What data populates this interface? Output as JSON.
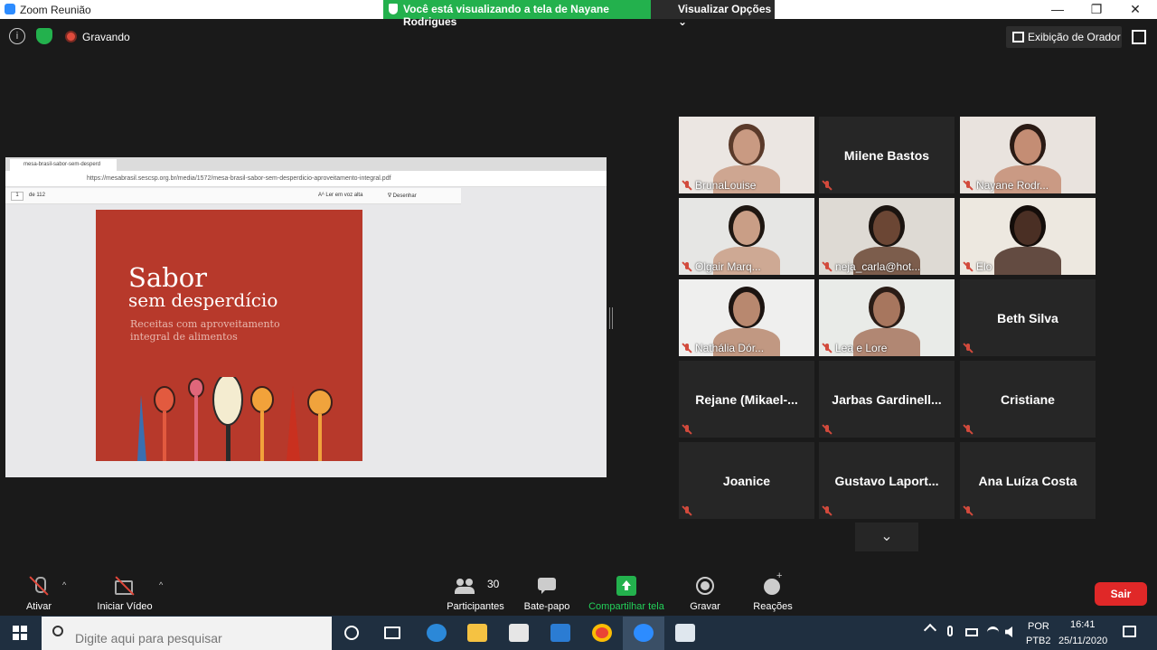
{
  "window": {
    "title": "Zoom Reunião",
    "share_banner": "Você está visualizando a tela de Nayane Rodrigues",
    "view_options": "Visualizar Opções ⌄",
    "minimize": "—",
    "maximize": "❐",
    "close": "✕"
  },
  "meeting": {
    "info_glyph": "i",
    "recording_label": "Gravando",
    "speaker_view_label": "Exibição de Orador"
  },
  "shared_screen": {
    "tab_title": "mesa-brasil-sabor-sem-desperd",
    "url": "https://mesabrasil.sescsp.org.br/media/1572/mesa-brasil-sabor-sem-desperdicio-aproveitamento-integral.pdf",
    "page_number": "1",
    "page_count": "de 112",
    "read_aloud": "Aᴬ Ler em voz alta",
    "draw": "∇ Desenhar",
    "cover_title_1": "Sabor",
    "cover_title_2": "sem desperdício",
    "cover_subtitle": "Receitas com aproveitamento integral de alimentos"
  },
  "participants": [
    {
      "name": "BrunaLouise",
      "video": true,
      "active": false,
      "skin": "#c99a82",
      "bg": "#ebe6e2",
      "hair": "#5a3a2a"
    },
    {
      "name": "Milene Bastos",
      "video": false,
      "active": false
    },
    {
      "name": "Nayane Rodr...",
      "video": true,
      "active": false,
      "skin": "#c48d74",
      "bg": "#e9e3de",
      "hair": "#2a1a14"
    },
    {
      "name": "Olgair Marq...",
      "video": true,
      "active": false,
      "skin": "#c99e86",
      "bg": "#e6e6e4",
      "hair": "#1f1712"
    },
    {
      "name": "neja_carla@hot...",
      "video": true,
      "active": true,
      "skin": "#6b4634",
      "bg": "#dedad4",
      "hair": "#1b1410"
    },
    {
      "name": "Elo",
      "video": true,
      "active": false,
      "skin": "#4a2f24",
      "bg": "#ede8e0",
      "hair": "#140d0a"
    },
    {
      "name": "Nathália Dór...",
      "video": true,
      "active": false,
      "skin": "#b8886f",
      "bg": "#efefee",
      "hair": "#1c1411"
    },
    {
      "name": "Lea e Lore",
      "video": true,
      "active": false,
      "skin": "#a7765e",
      "bg": "#e9ebe8",
      "hair": "#2a1c16"
    },
    {
      "name": "Beth Silva",
      "video": false,
      "active": false
    },
    {
      "name": "Rejane  (Mikael-...",
      "video": false,
      "active": false
    },
    {
      "name": "Jarbas  Gardinell...",
      "video": false,
      "active": false
    },
    {
      "name": "Cristiane",
      "video": false,
      "active": false
    },
    {
      "name": "Joanice",
      "video": false,
      "active": false
    },
    {
      "name": "Gustavo  Laport...",
      "video": false,
      "active": false
    },
    {
      "name": "Ana Luíza Costa",
      "video": false,
      "active": false
    }
  ],
  "gallery_next": "⌄",
  "toolbar": {
    "unmute": "Ativar",
    "start_video": "Iniciar Vídeo",
    "participants": "Participantes",
    "participant_count": "30",
    "chat": "Bate-papo",
    "share": "Compartilhar tela",
    "record": "Gravar",
    "reactions": "Reações",
    "leave": "Sair",
    "caret": "^"
  },
  "taskbar": {
    "search_placeholder": "Digite aqui para pesquisar",
    "lang_1": "POR",
    "lang_2": "PTB2",
    "time": "16:41",
    "date": "25/11/2020"
  },
  "colors": {
    "accent_green": "#23b14d",
    "zoom_blue": "#2d8cff",
    "leave_red": "#e02828",
    "active_speaker": "#d6e74a"
  }
}
